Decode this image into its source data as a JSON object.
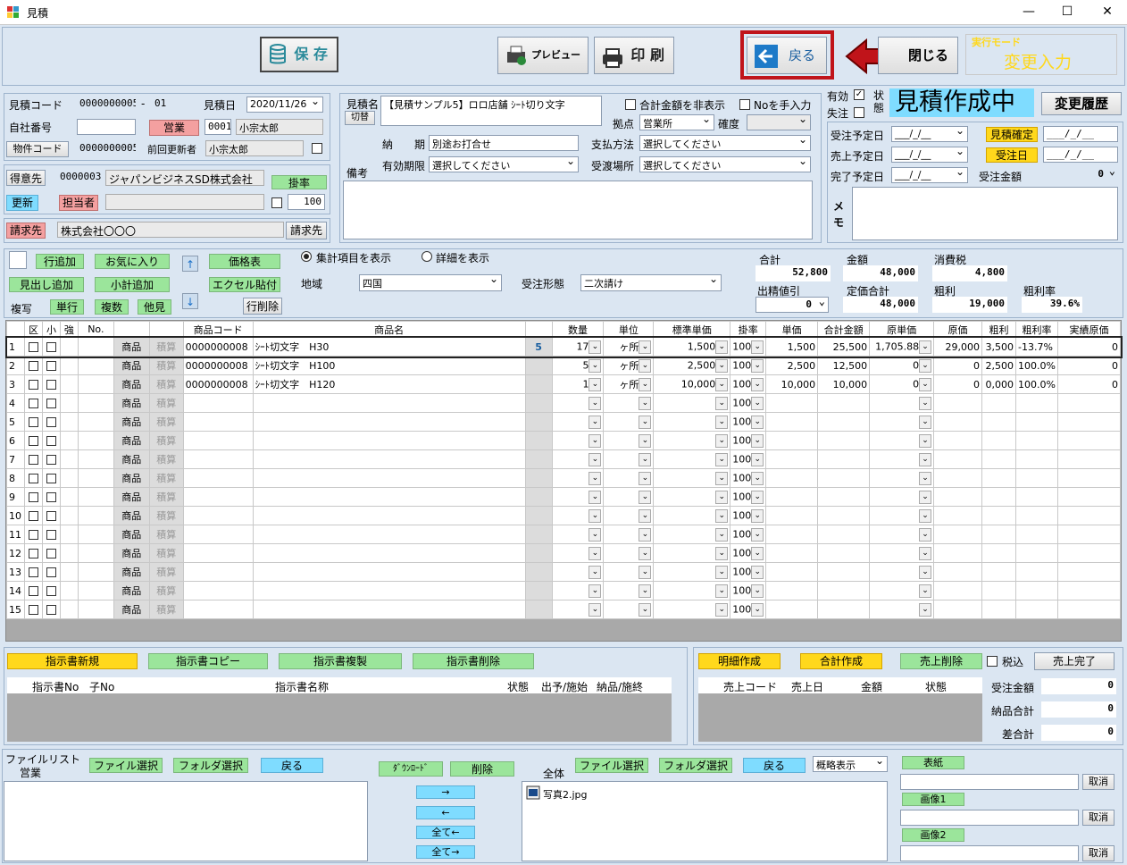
{
  "window": {
    "title": "見積",
    "min": "—",
    "max": "☐",
    "close": "✕"
  },
  "toolbar": {
    "save": "保 存",
    "preview": "プレビュー",
    "print": "印 刷",
    "back": "戻る",
    "close": "閉じる",
    "mode_label": "実行モード",
    "mode_value": "変更入力"
  },
  "header": {
    "quote_code_label": "見積コード",
    "quote_code": "0000000005",
    "dash": "-",
    "branch": "01",
    "quote_date_label": "見積日",
    "quote_date": "2020/11/26",
    "own_no_label": "自社番号",
    "own_no": "",
    "sales_btn": "営業",
    "sales_code": "0001",
    "sales_name": "小宗太郎",
    "property_code_btn": "物件コード",
    "property_code": "0000000005",
    "updater_label": "前回更新者",
    "updater": "小宗太郎",
    "customer_btn": "得意先",
    "customer_code": "0000003",
    "customer_name": "ジャパンビジネスSD株式会社",
    "rate_btn": "掛率",
    "rate": "100",
    "update_btn": "更新",
    "staff_btn": "担当者",
    "billing_btn": "請求先",
    "billing_name": "株式会社〇〇〇",
    "billing_btn2": "請求先"
  },
  "quote": {
    "name_label": "見積名",
    "switch_btn": "切替",
    "name": "【見積サンプル5】ロロ店舗 ｼｰﾄ切り文字",
    "hide_total_label": "合計金額を非表示",
    "manual_no_label": "Noを手入力",
    "base_label": "拠点",
    "base": "営業所",
    "certainty_label": "確度",
    "certainty": "",
    "delivery_label": "納　　期",
    "delivery": "別途お打合せ",
    "payment_label": "支払方法",
    "payment": "選択してください",
    "validity_label": "有効期限",
    "validity": "選択してください",
    "handover_label": "受渡場所",
    "handover": "選択してください",
    "note_label": "備考"
  },
  "status": {
    "valid_label": "有効",
    "lost_label": "失注",
    "state_label": "状態",
    "state": "見積作成中",
    "history_btn": "変更履歴",
    "order_plan_label": "受注予定日",
    "order_plan": "___/_/__",
    "quote_confirm_btn": "見積確定",
    "quote_confirm": "___/_/__",
    "sales_plan_label": "売上予定日",
    "sales_plan": "___/_/__",
    "order_date_btn": "受注日",
    "order_date": "___/_/__",
    "complete_plan_label": "完了予定日",
    "complete_plan": "___/_/__",
    "order_amount_label": "受注金額",
    "order_amount": "0",
    "memo_label": "メ\nモ"
  },
  "lineops": {
    "add_row": "行追加",
    "favorite": "お気に入り",
    "price_table": "価格表",
    "add_heading": "見出し追加",
    "add_subtotal": "小計追加",
    "excel_paste": "エクセル貼付",
    "copy_label": "複写",
    "single": "単行",
    "multi": "複数",
    "other": "他見",
    "del_row": "行削除",
    "up": "↑",
    "down": "↓",
    "show_summary": "集計項目を表示",
    "show_detail": "詳細を表示",
    "region_label": "地域",
    "region": "四国",
    "order_type_label": "受注形態",
    "order_type": "二次請け"
  },
  "totals": {
    "total_label": "合計",
    "total": "52,800",
    "amount_label": "金額",
    "amount": "48,000",
    "tax_label": "消費税",
    "tax": "4,800",
    "discount_label": "出精値引",
    "discount": "0",
    "list_total_label": "定価合計",
    "list_total": "48,000",
    "gross_label": "粗利",
    "gross": "19,000",
    "gross_rate_label": "粗利率",
    "gross_rate": "39.6%"
  },
  "grid": {
    "headers": [
      "区",
      "小",
      "強",
      "No.",
      "",
      "",
      "商品コード",
      "商品名",
      "",
      "数量",
      "単位",
      "標準単価",
      "掛率",
      "単価",
      "合計金額",
      "原単価",
      "原価",
      "粗利",
      "粗利率",
      "実績原価"
    ],
    "rows": [
      {
        "n": "1",
        "b1": "商品",
        "b2": "積算",
        "code": "0000000008",
        "name": "ｼｰﾄ切文字　H30",
        "mark": "5",
        "qty": "17",
        "unit": "ヶ所",
        "std": "1,500",
        "rate": "100",
        "price": "1,500",
        "total": "25,500",
        "cu": "1,705.88",
        "cost": "29,000",
        "gp": "3,500",
        "gpr": "-13.7%",
        "act": "0"
      },
      {
        "n": "2",
        "b1": "商品",
        "b2": "積算",
        "code": "0000000008",
        "name": "ｼｰﾄ切文字　H100",
        "mark": "",
        "qty": "5",
        "unit": "ヶ所",
        "std": "2,500",
        "rate": "100",
        "price": "2,500",
        "total": "12,500",
        "cu": "0",
        "cost": "0",
        "gp": "2,500",
        "gpr": "100.0%",
        "act": "0"
      },
      {
        "n": "3",
        "b1": "商品",
        "b2": "積算",
        "code": "0000000008",
        "name": "ｼｰﾄ切文字　H120",
        "mark": "",
        "qty": "1",
        "unit": "ヶ所",
        "std": "10,000",
        "rate": "100",
        "price": "10,000",
        "total": "10,000",
        "cu": "0",
        "cost": "0",
        "gp": "0,000",
        "gpr": "100.0%",
        "act": "0"
      },
      {
        "n": "4",
        "b1": "商品",
        "b2": "積算",
        "rate": "100"
      },
      {
        "n": "5",
        "b1": "商品",
        "b2": "積算",
        "rate": "100"
      },
      {
        "n": "6",
        "b1": "商品",
        "b2": "積算",
        "rate": "100"
      },
      {
        "n": "7",
        "b1": "商品",
        "b2": "積算",
        "rate": "100"
      },
      {
        "n": "8",
        "b1": "商品",
        "b2": "積算",
        "rate": "100"
      },
      {
        "n": "9",
        "b1": "商品",
        "b2": "積算",
        "rate": "100"
      },
      {
        "n": "10",
        "b1": "商品",
        "b2": "積算",
        "rate": "100"
      },
      {
        "n": "11",
        "b1": "商品",
        "b2": "積算",
        "rate": "100"
      },
      {
        "n": "12",
        "b1": "商品",
        "b2": "積算",
        "rate": "100"
      },
      {
        "n": "13",
        "b1": "商品",
        "b2": "積算",
        "rate": "100"
      },
      {
        "n": "14",
        "b1": "商品",
        "b2": "積算",
        "rate": "100"
      },
      {
        "n": "15",
        "b1": "商品",
        "b2": "積算",
        "rate": "100"
      }
    ]
  },
  "instructions": {
    "new": "指示書新規",
    "copy": "指示書コピー",
    "duplicate": "指示書複製",
    "delete": "指示書削除",
    "headers": [
      "指示書No",
      "子No",
      "指示書名称",
      "状態",
      "出予/施始",
      "納品/施終"
    ]
  },
  "sales": {
    "detail": "明細作成",
    "total": "合計作成",
    "delete": "売上削除",
    "tax_incl": "税込",
    "complete": "売上完了",
    "headers": [
      "売上コード",
      "売上日",
      "金額",
      "状態"
    ],
    "order_amount_label": "受注金額",
    "order_amount": "0",
    "delivery_total_label": "納品合計",
    "delivery_total": "0",
    "diff_label": "差合計",
    "diff": "0"
  },
  "files": {
    "list_label": "ファイルリスト",
    "dept": "営業",
    "file_select": "ファイル選択",
    "folder_select": "フォルダ選択",
    "back": "戻る",
    "download": "ﾀﾞｳﾝﾛｰﾄﾞ",
    "delete": "削除",
    "all_label": "全体",
    "file_select2": "ファイル選択",
    "folder_select2": "フォルダ選択",
    "back2": "戻る",
    "view_mode": "概略表示",
    "right": "→",
    "left": "←",
    "all_left": "全て←",
    "all_right": "全て→",
    "file1": "写真2.jpg",
    "cover": "表紙",
    "image1": "画像1",
    "image2": "画像2",
    "cancel": "取消"
  }
}
